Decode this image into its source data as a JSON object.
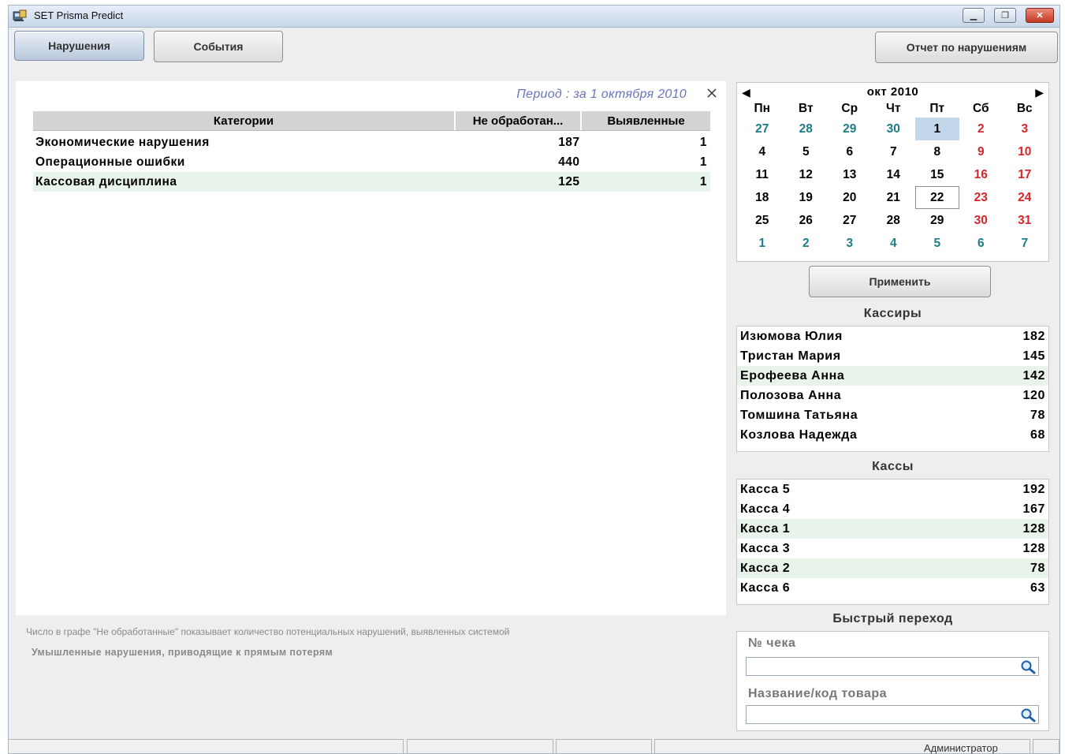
{
  "window": {
    "title": "SET Prisma Predict",
    "controls": [
      "minimize",
      "restore",
      "close"
    ]
  },
  "toolbar": {
    "tab_violations": "Нарушения",
    "tab_events": "События",
    "report_button": "Отчет по нарушениям"
  },
  "main": {
    "period": "Период : за 1 октября 2010",
    "columns": [
      "Категории",
      "Не обработан...",
      "Выявленные"
    ],
    "rows": [
      {
        "category": "Экономические нарушения",
        "unprocessed": "187",
        "detected": "1"
      },
      {
        "category": "Операционные ошибки",
        "unprocessed": "440",
        "detected": "1"
      },
      {
        "category": "Кассовая дисциплина",
        "unprocessed": "125",
        "detected": "1"
      }
    ],
    "note_unprocessed": "Число в графе \"Не обработанные\" показывает количество потенциальных нарушений, выявленных системой",
    "note_intent": "Умышленные нарушения, приводящие к прямым потерям"
  },
  "calendar": {
    "month": "окт 2010",
    "weekdays": [
      "Пн",
      "Вт",
      "Ср",
      "Чт",
      "Пт",
      "Сб",
      "Вс"
    ],
    "days": [
      [
        "27",
        "28",
        "29",
        "30",
        "1",
        "2",
        "3"
      ],
      [
        "4",
        "5",
        "6",
        "7",
        "8",
        "9",
        "10"
      ],
      [
        "11",
        "12",
        "13",
        "14",
        "15",
        "16",
        "17"
      ],
      [
        "18",
        "19",
        "20",
        "21",
        "22",
        "23",
        "24"
      ],
      [
        "25",
        "26",
        "27",
        "28",
        "29",
        "30",
        "31"
      ],
      [
        "1",
        "2",
        "3",
        "4",
        "5",
        "6",
        "7"
      ]
    ],
    "selected": "1",
    "today": "22",
    "apply_button": "Применить",
    "colors": {
      "other_month": "#1d7d86",
      "weekend": "#d8252b",
      "selected_bg": "#c3d7ea"
    }
  },
  "cashiers": {
    "title": "Кассиры",
    "items": [
      {
        "name": "Изюмова Юлия",
        "count": "182"
      },
      {
        "name": "Тристан Мария",
        "count": "145"
      },
      {
        "name": "Ерофеева Анна",
        "count": "142"
      },
      {
        "name": "Полозова Анна",
        "count": "120"
      },
      {
        "name": "Томшина Татьяна",
        "count": "78"
      },
      {
        "name": "Козлова Надежда",
        "count": "68"
      }
    ]
  },
  "registers": {
    "title": "Кассы",
    "items": [
      {
        "name": "Касса 5",
        "count": "192"
      },
      {
        "name": "Касса 4",
        "count": "167"
      },
      {
        "name": "Касса 1",
        "count": "128"
      },
      {
        "name": "Касса 3",
        "count": "128"
      },
      {
        "name": "Касса 2",
        "count": "78"
      },
      {
        "name": "Касса 6",
        "count": "63"
      }
    ]
  },
  "quick": {
    "title": "Быстрый переход",
    "receipt_label": "№ чека",
    "receipt_value": "",
    "product_label": "Название/код товара",
    "product_value": ""
  },
  "status": {
    "user": "Администратор"
  }
}
